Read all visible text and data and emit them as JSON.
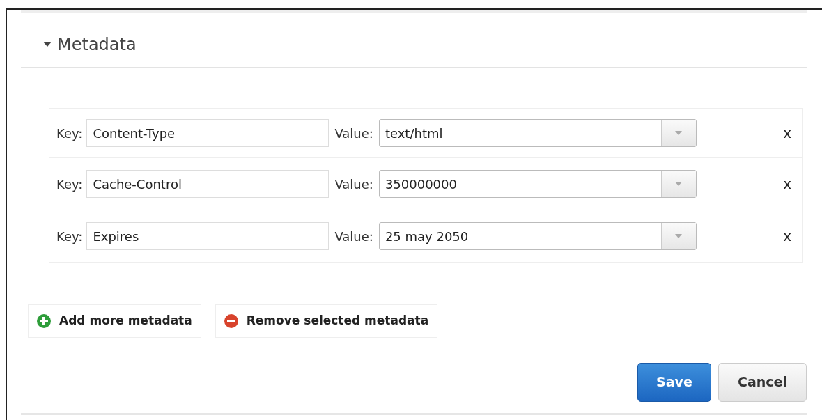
{
  "section": {
    "title": "Metadata",
    "expanded": true
  },
  "rows": [
    {
      "key_label": "Key:",
      "key": "Content-Type",
      "value_label": "Value:",
      "value": "text/html",
      "remove": "x"
    },
    {
      "key_label": "Key:",
      "key": "Cache-Control",
      "value_label": "Value:",
      "value": "350000000",
      "remove": "x"
    },
    {
      "key_label": "Key:",
      "key": "Expires",
      "value_label": "Value:",
      "value": "25 may 2050",
      "remove": "x"
    }
  ],
  "actions": [
    {
      "label": "Add more metadata",
      "kind": "add"
    },
    {
      "label": "Remove selected metadata",
      "kind": "remove"
    }
  ],
  "buttons": [
    {
      "label": "Save",
      "kind": "primary"
    },
    {
      "label": "Cancel",
      "kind": "secondary"
    }
  ]
}
